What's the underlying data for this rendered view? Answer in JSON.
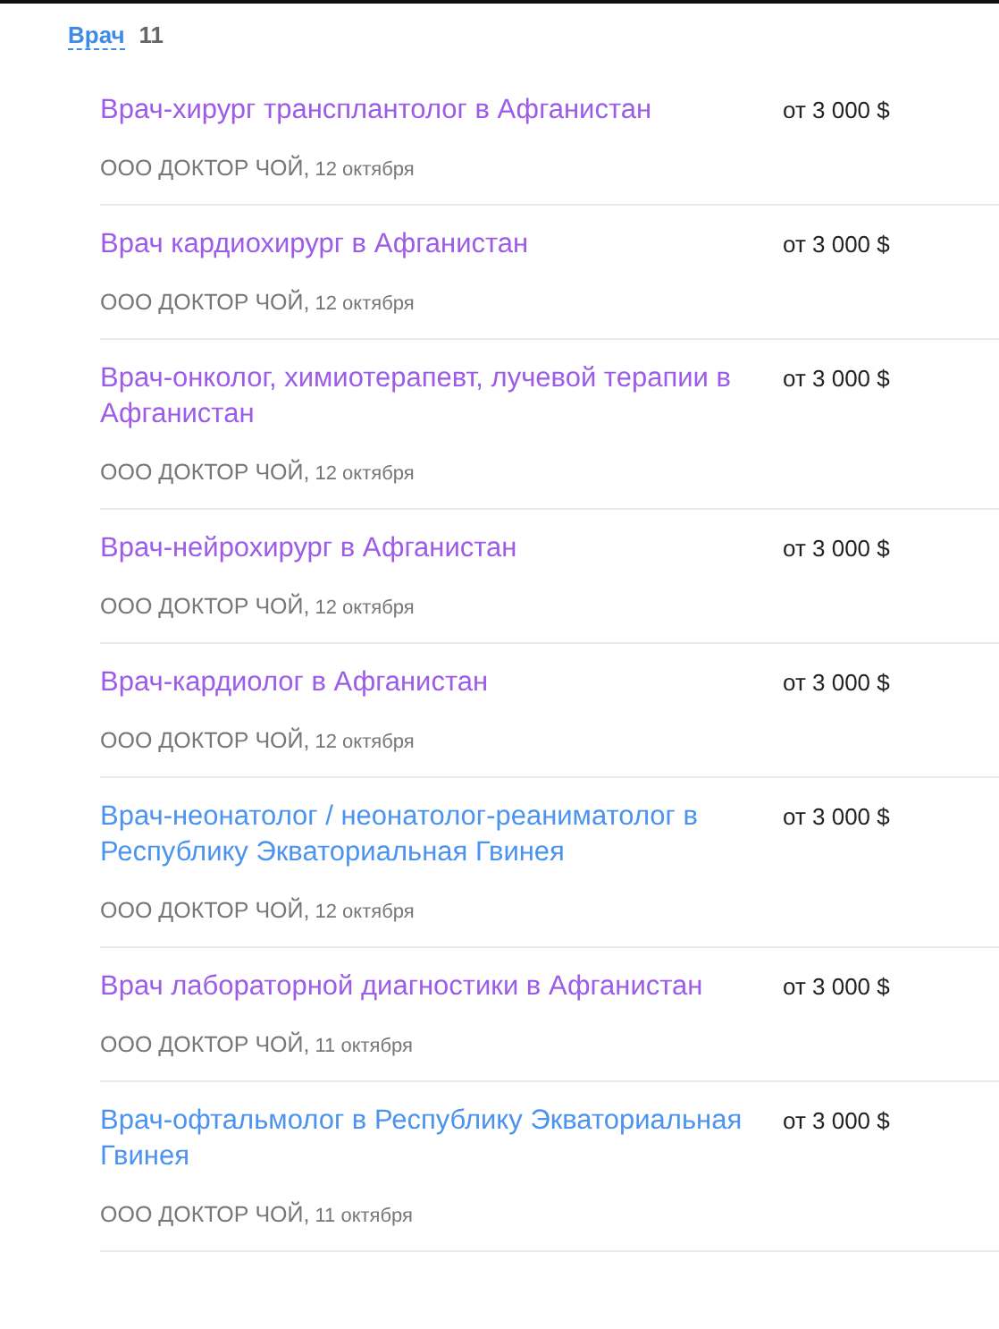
{
  "category": {
    "label": "Врач",
    "count": "11"
  },
  "vacancies": [
    {
      "title": "Врач-хирург трансплантолог в Афганистан",
      "visited": true,
      "salary": "от 3 000 $",
      "company": "ООО ДОКТОР ЧОЙ,",
      "date": "12 октября"
    },
    {
      "title": "Врач кардиохирург в Афганистан",
      "visited": true,
      "salary": "от 3 000 $",
      "company": "ООО ДОКТОР ЧОЙ,",
      "date": "12 октября"
    },
    {
      "title": "Врач-онколог, химиотерапевт, лучевой терапии в Афганистан",
      "visited": true,
      "salary": "от 3 000 $",
      "company": "ООО ДОКТОР ЧОЙ,",
      "date": "12 октября"
    },
    {
      "title": "Врач-нейрохирург в Афганистан",
      "visited": true,
      "salary": "от 3 000 $",
      "company": "ООО ДОКТОР ЧОЙ,",
      "date": "12 октября"
    },
    {
      "title": "Врач-кардиолог в Афганистан",
      "visited": true,
      "salary": "от 3 000 $",
      "company": "ООО ДОКТОР ЧОЙ,",
      "date": "12 октября"
    },
    {
      "title": "Врач-неонатолог / неонатолог-реаниматолог в Республику Экваториальная Гвинея",
      "visited": false,
      "salary": "от 3 000 $",
      "company": "ООО ДОКТОР ЧОЙ,",
      "date": "12 октября"
    },
    {
      "title": "Врач лабораторной диагностики в Афганистан",
      "visited": true,
      "salary": "от 3 000 $",
      "company": "ООО ДОКТОР ЧОЙ,",
      "date": "11 октября"
    },
    {
      "title": "Врач-офтальмолог в Республику Экваториальная Гвинея",
      "visited": false,
      "salary": "от 3 000 $",
      "company": "ООО ДОКТОР ЧОЙ,",
      "date": "11 октября"
    }
  ]
}
